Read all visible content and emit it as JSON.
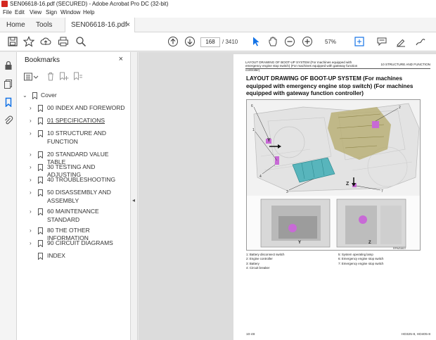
{
  "window": {
    "title": "SEN06618-16.pdf (SECURED) - Adobe Acrobat Pro DC (32-bit)"
  },
  "menu": [
    "File",
    "Edit",
    "View",
    "Sign",
    "Window",
    "Help"
  ],
  "tabs": {
    "home": "Home",
    "tools": "Tools",
    "document": "SEN06618-16.pdf (...",
    "close": "×"
  },
  "toolbar": {
    "page_current": "168",
    "page_total": "/ 3410",
    "zoom": "57%"
  },
  "bookmarks_panel": {
    "title": "Bookmarks",
    "close": "×",
    "items": [
      {
        "label": "Cover",
        "level": 0,
        "expanded": true
      },
      {
        "label": "00 INDEX AND FOREWORD",
        "level": 1
      },
      {
        "label": "01 SPECIFICATIONS",
        "level": 1,
        "underline": true
      },
      {
        "label": "10 STRUCTURE AND",
        "label2": "FUNCTION",
        "level": 1
      },
      {
        "label": "20 STANDARD VALUE TABLE",
        "level": 1
      },
      {
        "label": "30 TESTING AND ADJUSTING",
        "level": 1
      },
      {
        "label": "40 TROUBLESHOOTING",
        "level": 1
      },
      {
        "label": "50 DISASSEMBLY AND",
        "label2": "ASSEMBLY",
        "level": 1
      },
      {
        "label": "60 MAINTENANCE",
        "label2": "STANDARD",
        "level": 1
      },
      {
        "label": "80 THE OTHER INFORMATION",
        "level": 1
      },
      {
        "label": "90 CIRCUIT DIAGRAMS",
        "level": 1
      },
      {
        "label": "INDEX",
        "level": 1,
        "leaf": true
      }
    ]
  },
  "pdf_page": {
    "header_left": "LAYOUT DRAWING OF BOOT-UP SYSTEM (For machines equipped with emergency engine stop switch) (For machines equipped with gateway function controller)",
    "header_right": "10 STRUCTURE AND FUNCTION",
    "title": "LAYOUT DRAWING OF BOOT-UP SYSTEM (For machines equipped with emergency engine stop switch) (For machines equipped with gateway function controller)",
    "figure_code": "RPW33837",
    "figure_labels": {
      "y": "Y",
      "z": "Z"
    },
    "legend_left": [
      "1: Battery disconnect switch",
      "2: Engine controller",
      "3: Battery",
      "4: Circuit breaker"
    ],
    "legend_right": [
      "5: System operating lamp",
      "6: Emergency engine stop switch",
      "7: Emergency engine stop switch"
    ],
    "footer_left": "10-48",
    "footer_right": "HD325-8, HD405-8"
  },
  "colors": {
    "accent_blue": "#1473e6",
    "pdf_red": "#d4271f",
    "magenta_part": "#c86ad6"
  }
}
